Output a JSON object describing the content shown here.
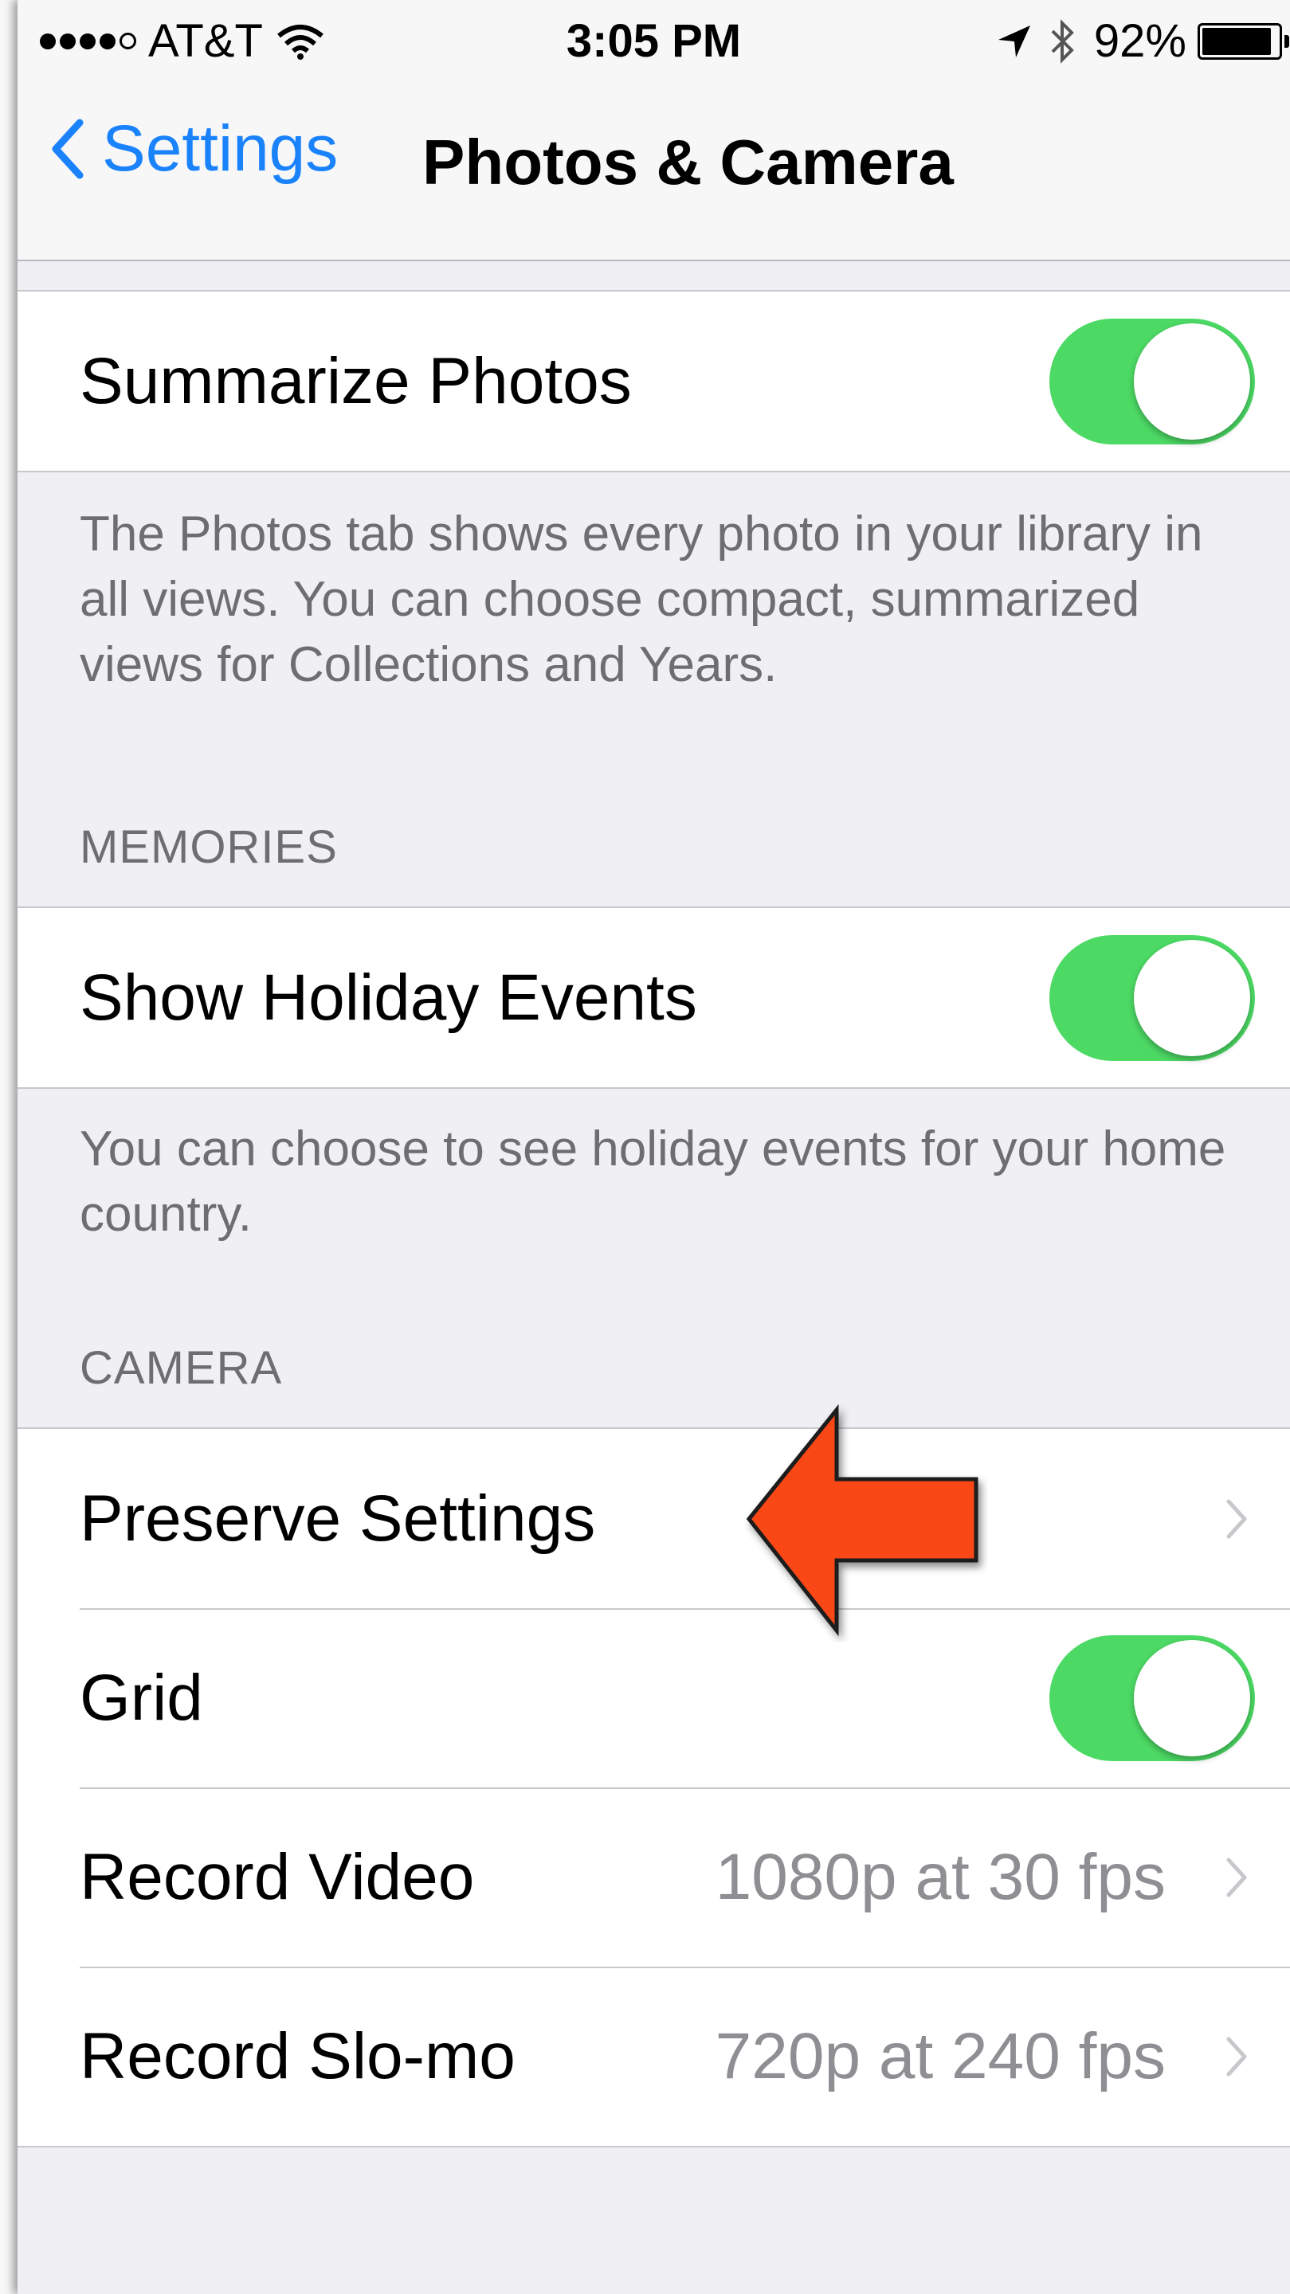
{
  "status_bar": {
    "carrier": "AT&T",
    "time": "3:05 PM",
    "battery_percent": "92%",
    "battery_level": 0.92,
    "icons": [
      "signal-dots-icon",
      "wifi-icon",
      "location-arrow-icon",
      "bluetooth-icon",
      "battery-icon"
    ]
  },
  "nav": {
    "back_label": "Settings",
    "title": "Photos & Camera"
  },
  "photos": {
    "summarize_label": "Summarize Photos",
    "summarize_on": true,
    "footer": "The Photos tab shows every photo in your library in all views. You can choose compact, summarized views for Collections and Years."
  },
  "memories": {
    "header": "MEMORIES",
    "holiday_label": "Show Holiday Events",
    "holiday_on": true,
    "footer": "You can choose to see holiday events for your home country."
  },
  "camera": {
    "header": "CAMERA",
    "rows": [
      {
        "label": "Preserve Settings",
        "value": ""
      },
      {
        "label": "Grid",
        "toggle_on": true
      },
      {
        "label": "Record Video",
        "value": "1080p at 30 fps"
      },
      {
        "label": "Record Slo-mo",
        "value": "720p at 240 fps"
      }
    ]
  },
  "annotation": {
    "arrow_color": "#fa4616",
    "icon": "red-arrow-icon"
  },
  "colors": {
    "accent_blue": "#1a82fb",
    "toggle_green": "#4cd964",
    "background": "#efeff4"
  }
}
